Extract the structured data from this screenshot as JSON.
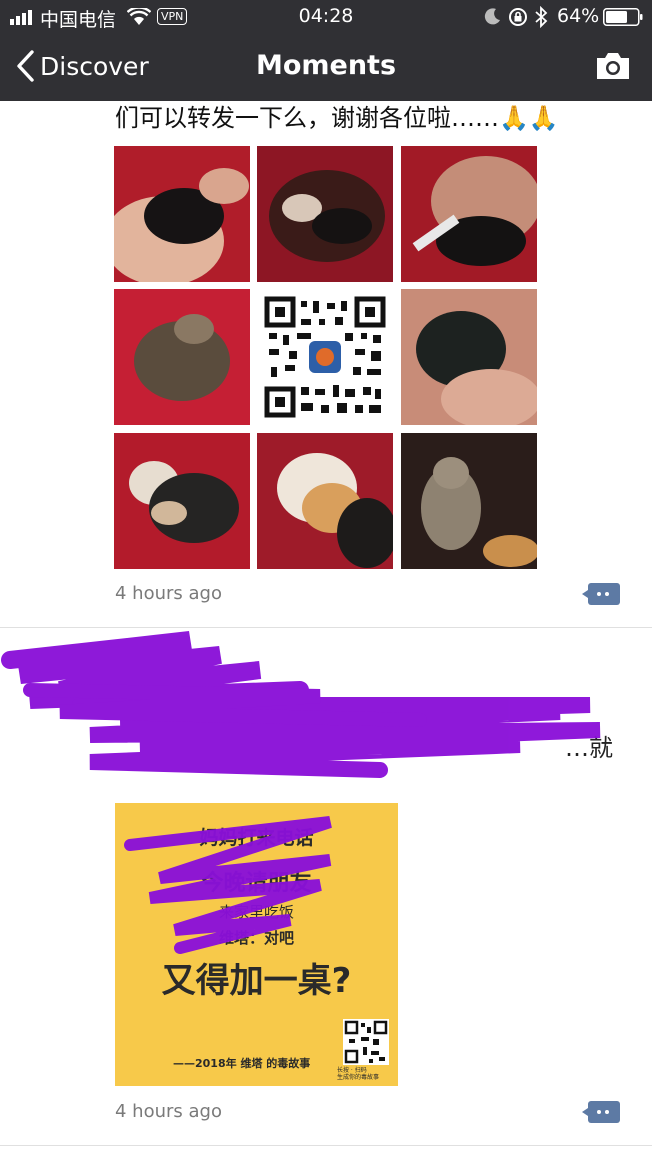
{
  "status_bar": {
    "carrier": "中国电信",
    "vpn": "VPN",
    "time": "04:28",
    "battery": "64%"
  },
  "nav": {
    "back_label": "Discover",
    "title": "Moments"
  },
  "posts": [
    {
      "text": "们可以转发一下么，谢谢各位啦……🙏🙏",
      "time": "4 hours ago"
    },
    {
      "text_lines": [
        "",
        "",
        "…就"
      ],
      "poster": {
        "line1": "妈妈打来电话",
        "line2": "今晚请朋友",
        "line3": "来家里吃饭",
        "line4": "维塔：对吧",
        "headline": "又得加一桌?",
        "footer": "——2018年 维塔 的毒故事",
        "qr_caption": "长按 · 扫码\n生成你的毒故事"
      },
      "time": "4 hours ago"
    }
  ],
  "colors": {
    "topbar": "#303034",
    "link_blue": "#5d7aa4",
    "poster_yellow": "#f7c94a",
    "scribble_purple": "#8a10d8"
  }
}
